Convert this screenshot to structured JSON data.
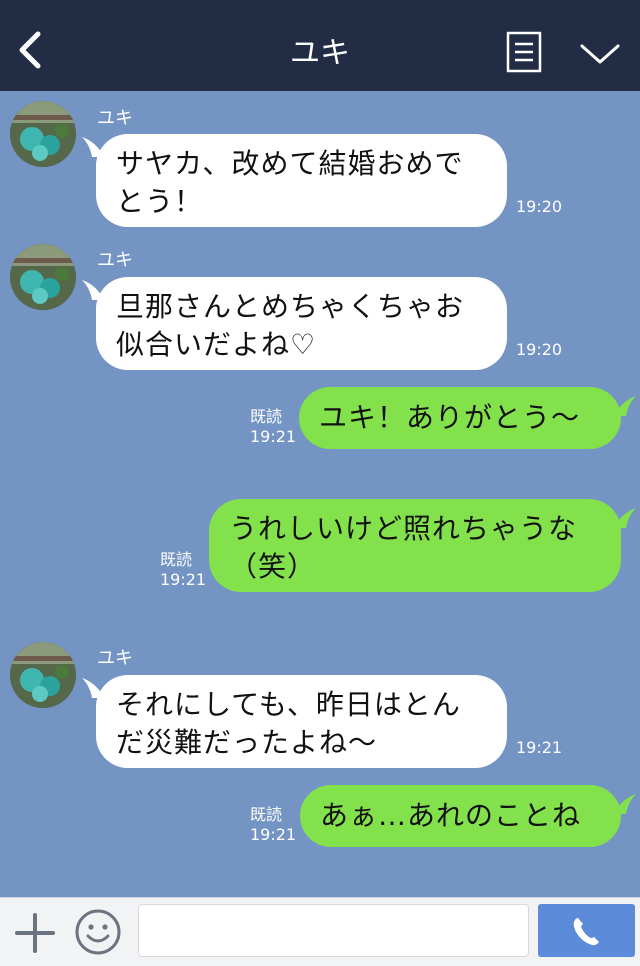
{
  "header": {
    "title": "ユキ",
    "back_icon": "chevron-left-icon",
    "menu_icon": "list-icon",
    "expand_icon": "chevron-down-icon"
  },
  "messages": [
    {
      "direction": "in",
      "sender": "ユキ",
      "lines": [
        "サヤカ、改めて結婚おめで",
        "とう！"
      ],
      "time": "19:20"
    },
    {
      "direction": "in",
      "sender": "ユキ",
      "lines": [
        "旦那さんとめちゃくちゃお",
        "似合いだよね♡"
      ],
      "time": "19:20"
    },
    {
      "direction": "out",
      "text": "ユキ！ありがとう〜",
      "read": "既読",
      "time": "19:21"
    },
    {
      "direction": "out",
      "lines": [
        "うれしいけど照れちゃうな",
        "（笑）"
      ],
      "read": "既読",
      "time": "19:21"
    },
    {
      "direction": "in",
      "sender": "ユキ",
      "lines": [
        "それにしても、昨日はとん",
        "だ災難だったよね〜"
      ],
      "time": "19:21"
    },
    {
      "direction": "out",
      "text": "あぁ…あれのことね",
      "read": "既読",
      "time": "19:21"
    }
  ],
  "input": {
    "plus_icon": "plus-icon",
    "emoji_icon": "smiley-icon",
    "call_icon": "phone-icon",
    "placeholder": ""
  },
  "colors": {
    "header_bg": "#222c44",
    "chat_bg": "#7494c4",
    "bubble_in": "#ffffff",
    "bubble_out": "#83e14b",
    "call_button": "#5b8bd9"
  }
}
